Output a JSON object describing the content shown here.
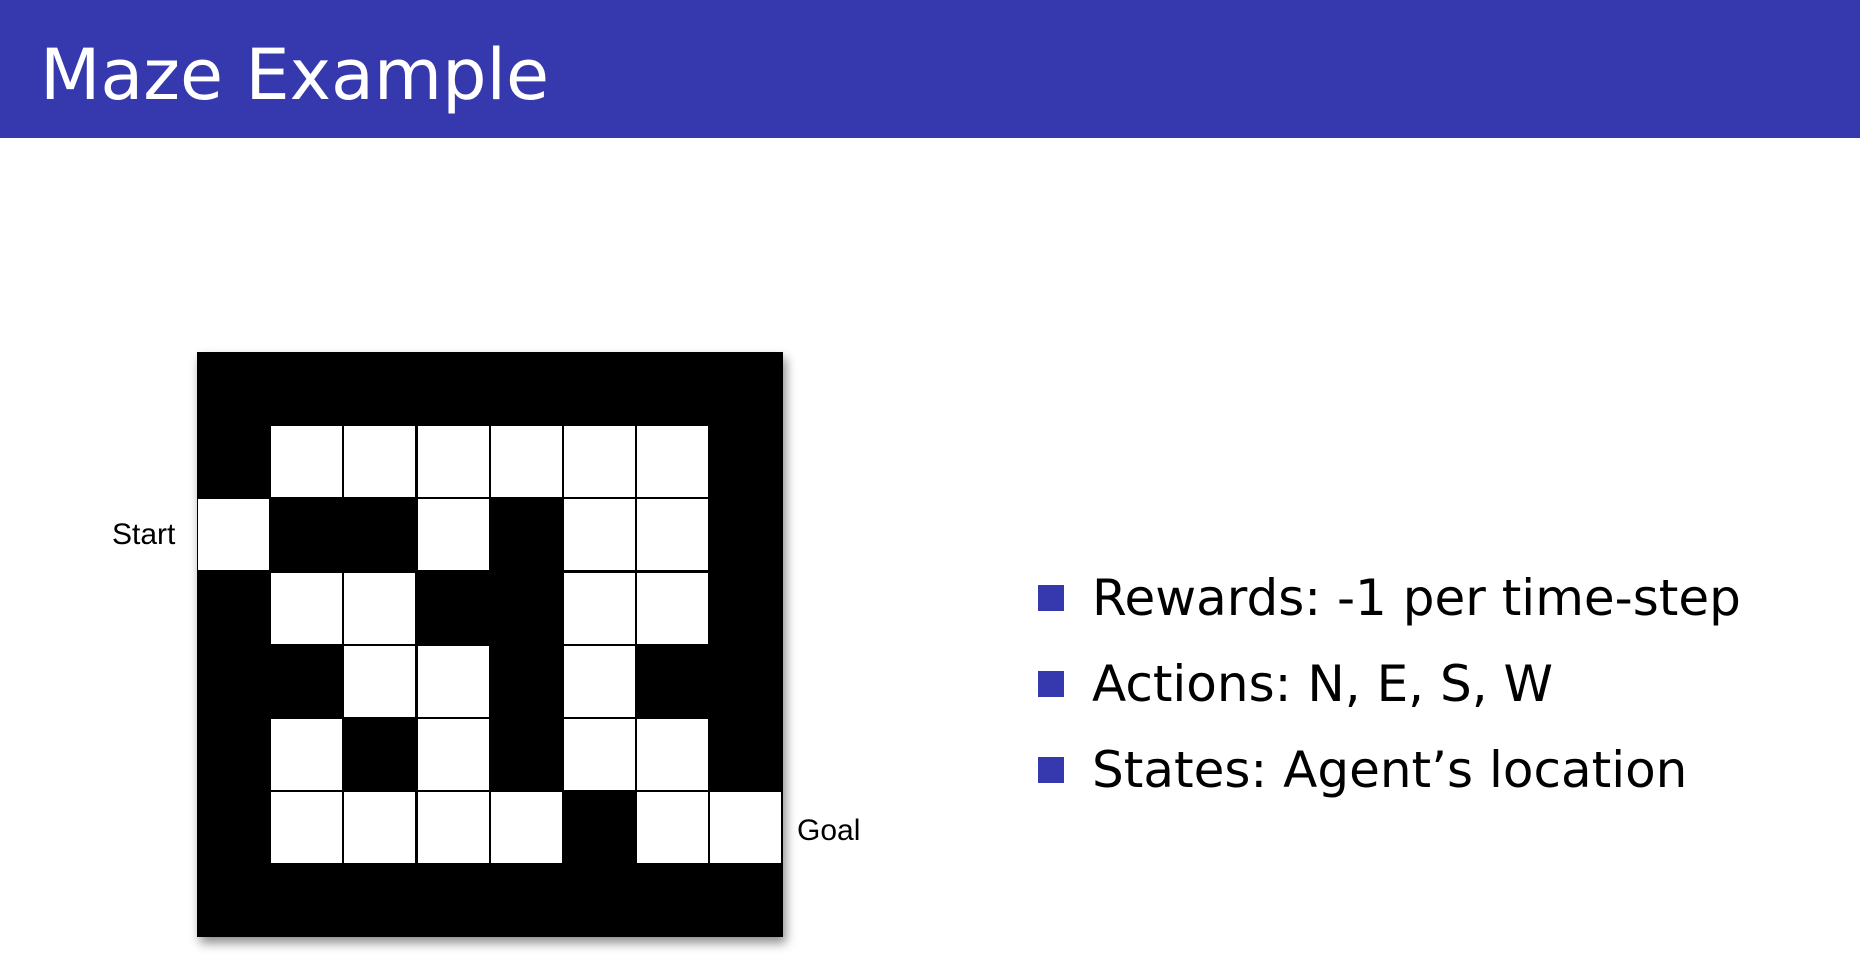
{
  "slide": {
    "title": "Maze Example",
    "accent_color": "#3638ae"
  },
  "maze": {
    "start_label": "Start",
    "goal_label": "Goal",
    "grid": [
      "########",
      "#......#",
      ".##.#..#",
      "#..##..#",
      "##..#.##",
      "#.#.#..#",
      "#....#..",
      "########"
    ]
  },
  "bullets": [
    {
      "icon": "square-bullet-icon",
      "text": "Rewards: -1 per time-step"
    },
    {
      "icon": "square-bullet-icon",
      "text": "Actions: N, E, S, W"
    },
    {
      "icon": "square-bullet-icon",
      "text": "States: Agent’s location"
    }
  ]
}
